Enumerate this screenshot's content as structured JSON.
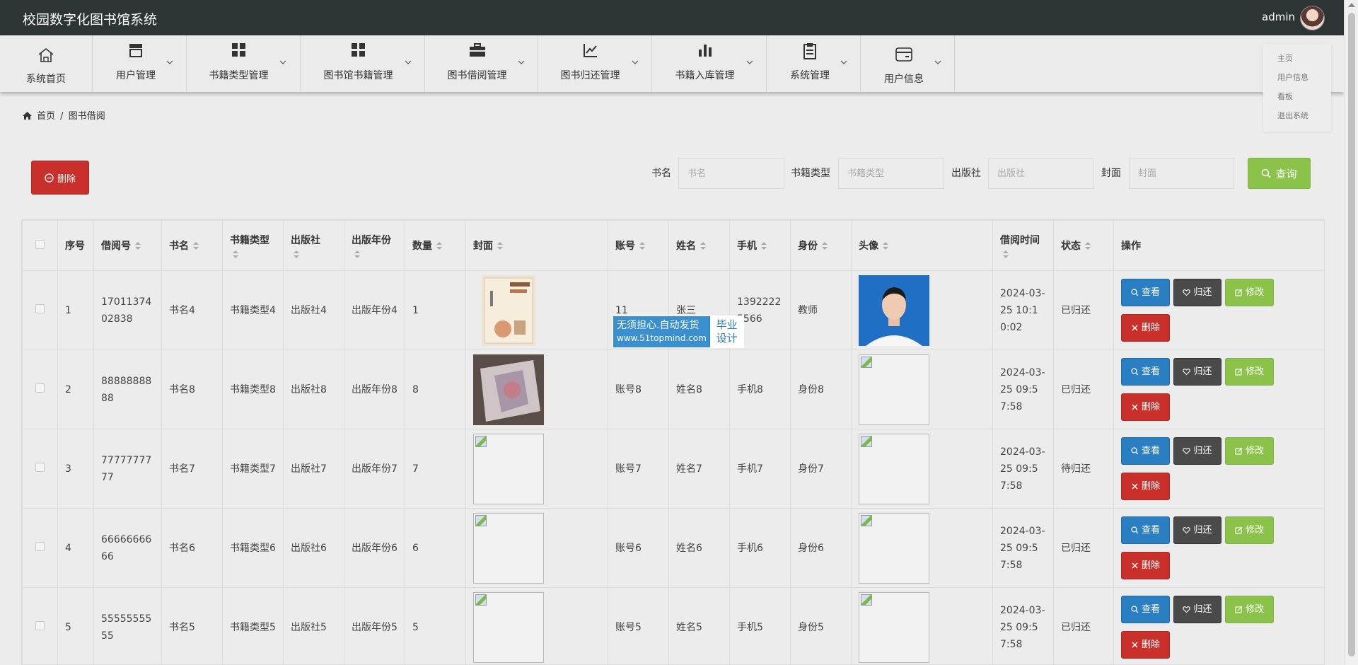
{
  "header": {
    "title": "校园数字化图书馆系统",
    "username": "admin"
  },
  "nav": [
    {
      "label": "系统首页",
      "icon": "home-icon"
    },
    {
      "label": "用户管理",
      "icon": "store-icon"
    },
    {
      "label": "书籍类型管理",
      "icon": "grid-icon"
    },
    {
      "label": "图书馆书籍管理",
      "icon": "grid-icon"
    },
    {
      "label": "图书借阅管理",
      "icon": "briefcase-icon"
    },
    {
      "label": "图书归还管理",
      "icon": "line-chart-icon"
    },
    {
      "label": "书籍入库管理",
      "icon": "bar-chart-icon"
    },
    {
      "label": "系统管理",
      "icon": "clipboard-icon"
    },
    {
      "label": "用户信息",
      "icon": "card-icon"
    }
  ],
  "user_menu": [
    "主页",
    "用户信息",
    "看板",
    "退出系统"
  ],
  "breadcrumb": {
    "home": "首页",
    "sep": "/",
    "current": "图书借阅"
  },
  "toolbar": {
    "delete_label": "删除"
  },
  "search": {
    "fields": [
      {
        "label": "书名",
        "placeholder": "书名"
      },
      {
        "label": "书籍类型",
        "placeholder": "书籍类型"
      },
      {
        "label": "出版社",
        "placeholder": "出版社"
      },
      {
        "label": "封面",
        "placeholder": "封面"
      }
    ],
    "query_label": "查询"
  },
  "table": {
    "headers": [
      "序号",
      "借阅号",
      "书名",
      "书籍类型",
      "出版社",
      "出版年份",
      "数量",
      "封面",
      "账号",
      "姓名",
      "手机",
      "身份",
      "头像",
      "借阅时间",
      "状态",
      "操作"
    ],
    "actions": {
      "view": "查看",
      "return": "归还",
      "edit": "修改",
      "delete": "删除"
    },
    "rows": [
      {
        "idx": "1",
        "borrow_no": "1701137402838",
        "book": "书名4",
        "type": "书籍类型4",
        "publisher": "出版社4",
        "year": "出版年份4",
        "qty": "1",
        "cover": "book-cover-photo",
        "account": "11",
        "name": "张三",
        "phone": "13922225566",
        "role": "教师",
        "avatar": "portrait-photo",
        "time": "2024-03-25 10:10:02",
        "status": "已归还"
      },
      {
        "idx": "2",
        "borrow_no": "8888888888",
        "book": "书名8",
        "type": "书籍类型8",
        "publisher": "出版社8",
        "year": "出版年份8",
        "qty": "8",
        "cover": "book-photo",
        "account": "账号8",
        "name": "姓名8",
        "phone": "手机8",
        "role": "身份8",
        "avatar": "broken-image",
        "time": "2024-03-25 09:57:58",
        "status": "已归还"
      },
      {
        "idx": "3",
        "borrow_no": "7777777777",
        "book": "书名7",
        "type": "书籍类型7",
        "publisher": "出版社7",
        "year": "出版年份7",
        "qty": "7",
        "cover": "broken-image",
        "account": "账号7",
        "name": "姓名7",
        "phone": "手机7",
        "role": "身份7",
        "avatar": "broken-image",
        "time": "2024-03-25 09:57:58",
        "status": "待归还"
      },
      {
        "idx": "4",
        "borrow_no": "6666666666",
        "book": "书名6",
        "type": "书籍类型6",
        "publisher": "出版社6",
        "year": "出版年份6",
        "qty": "6",
        "cover": "broken-image",
        "account": "账号6",
        "name": "姓名6",
        "phone": "手机6",
        "role": "身份6",
        "avatar": "broken-image",
        "time": "2024-03-25 09:57:58",
        "status": "已归还"
      },
      {
        "idx": "5",
        "borrow_no": "5555555555",
        "book": "书名5",
        "type": "书籍类型5",
        "publisher": "出版社5",
        "year": "出版年份5",
        "qty": "5",
        "cover": "broken-image",
        "account": "账号5",
        "name": "姓名5",
        "phone": "手机5",
        "role": "身份5",
        "avatar": "broken-image",
        "time": "2024-03-25 09:57:58",
        "status": "已归还"
      }
    ]
  },
  "watermark": {
    "line1": "无须担心.自动发货",
    "line2": "www.51topmind.com",
    "badge_line1": "毕业",
    "badge_line2": "设计"
  },
  "colors": {
    "topbar": "#2d3436",
    "danger": "#c9302c",
    "primary": "#2a7ec2",
    "success": "#8bc34a",
    "dark": "#4a4a4a"
  }
}
